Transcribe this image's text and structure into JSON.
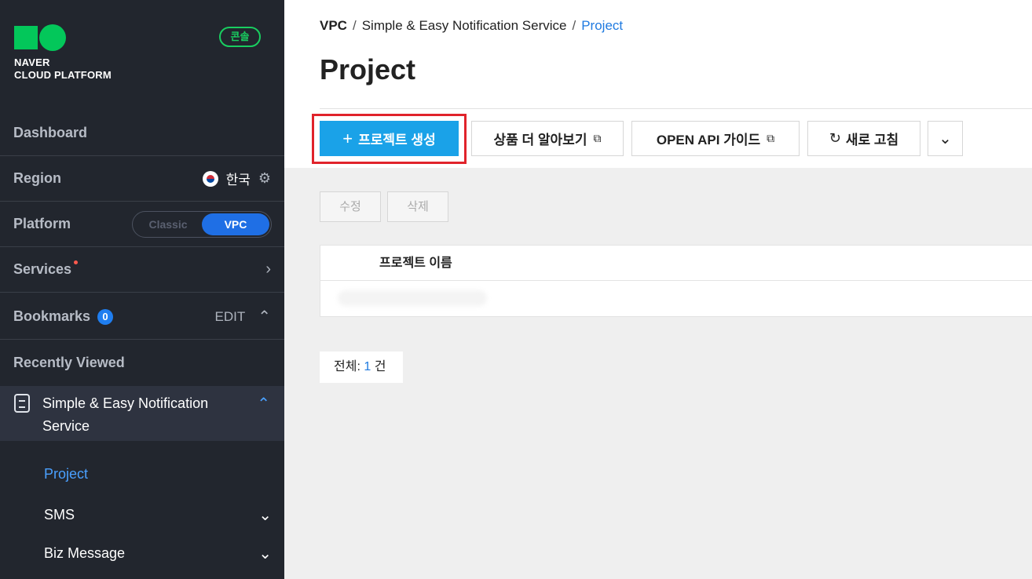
{
  "sidebar": {
    "logo_line1": "NAVER",
    "logo_line2": "CLOUD PLATFORM",
    "console_badge": "콘솔",
    "dashboard": "Dashboard",
    "region_label": "Region",
    "region_value": "한국",
    "platform_label": "Platform",
    "platform_options": [
      "Classic",
      "VPC"
    ],
    "platform_selected": "VPC",
    "services_label": "Services",
    "bookmarks_label": "Bookmarks",
    "bookmarks_count": "0",
    "bookmarks_edit": "EDIT",
    "recently_viewed": "Recently Viewed",
    "service_name": "Simple & Easy Notification Service",
    "sub_items": [
      {
        "label": "Project",
        "active": true
      },
      {
        "label": "SMS",
        "active": false
      },
      {
        "label": "Biz Message",
        "active": false
      }
    ]
  },
  "breadcrumb": {
    "items": [
      "VPC",
      "Simple & Easy Notification Service",
      "Project"
    ],
    "separator": "/"
  },
  "page_title": "Project",
  "toolbar": {
    "create_project": "프로젝트 생성",
    "learn_more": "상품 더 알아보기",
    "api_guide": "OPEN API 가이드",
    "refresh": "새로 고침"
  },
  "actions": {
    "edit": "수정",
    "delete": "삭제"
  },
  "table": {
    "columns": [
      "프로젝트 이름"
    ]
  },
  "total": {
    "label": "전체:",
    "count": "1",
    "unit": "건"
  },
  "colors": {
    "sidebar_bg": "#22262e",
    "brand_green": "#03c75a",
    "primary_button": "#1aa2e8",
    "highlight": "#e0232b",
    "link_blue": "#1f7ae0",
    "toggle_active": "#1f6fe5"
  }
}
